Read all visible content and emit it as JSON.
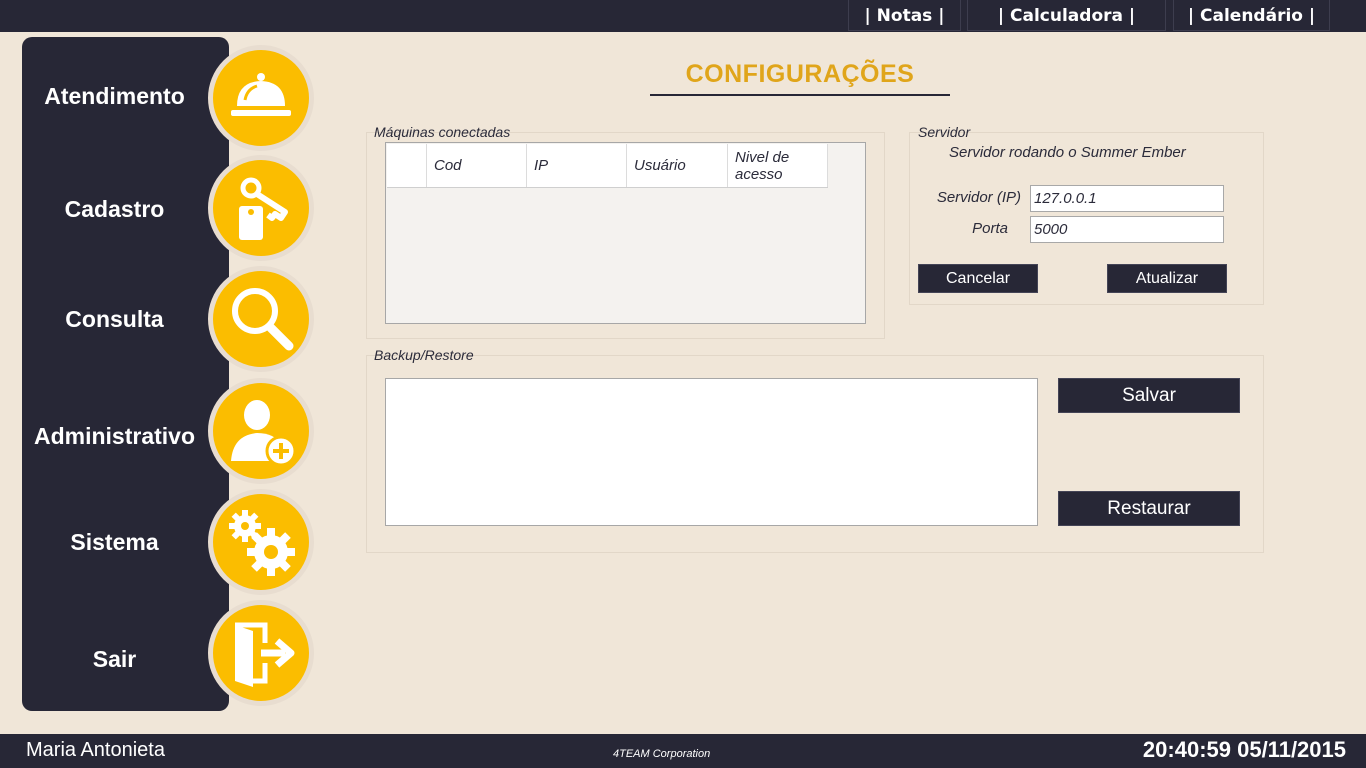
{
  "topnav": [
    {
      "label": "| Notas |"
    },
    {
      "label": "| Calculadora |"
    },
    {
      "label": "| Calendário |"
    }
  ],
  "sidebar": {
    "items": [
      {
        "label": "Atendimento",
        "icon": "service-bell-icon"
      },
      {
        "label": "Cadastro",
        "icon": "key-tag-icon"
      },
      {
        "label": "Consulta",
        "icon": "magnifier-icon"
      },
      {
        "label": "Administrativo",
        "icon": "add-user-icon"
      },
      {
        "label": "Sistema",
        "icon": "gears-icon"
      },
      {
        "label": "Sair",
        "icon": "exit-door-icon"
      }
    ]
  },
  "page": {
    "title": "CONFIGURAÇÕES"
  },
  "machines": {
    "group_label": "Máquinas conectadas",
    "columns": [
      "",
      "Cod",
      "IP",
      "Usuário",
      "Nivel de acesso"
    ],
    "rows": []
  },
  "server": {
    "group_label": "Servidor",
    "status": "Servidor rodando o Summer Ember",
    "ip_label": "Servidor (IP)",
    "ip_value": "127.0.0.1",
    "port_label": "Porta",
    "port_value": "5000",
    "cancel_label": "Cancelar",
    "update_label": "Atualizar"
  },
  "backup": {
    "group_label": "Backup/Restore",
    "text": "",
    "save_label": "Salvar",
    "restore_label": "Restaurar"
  },
  "status": {
    "user": "Maria Antonieta",
    "company": "4TEAM Corporation",
    "datetime": "20:40:59 05/11/2015"
  },
  "colors": {
    "dark": "#272736",
    "accent": "#fbbd00",
    "title": "#e0a51a",
    "background": "#f0e6d8"
  }
}
